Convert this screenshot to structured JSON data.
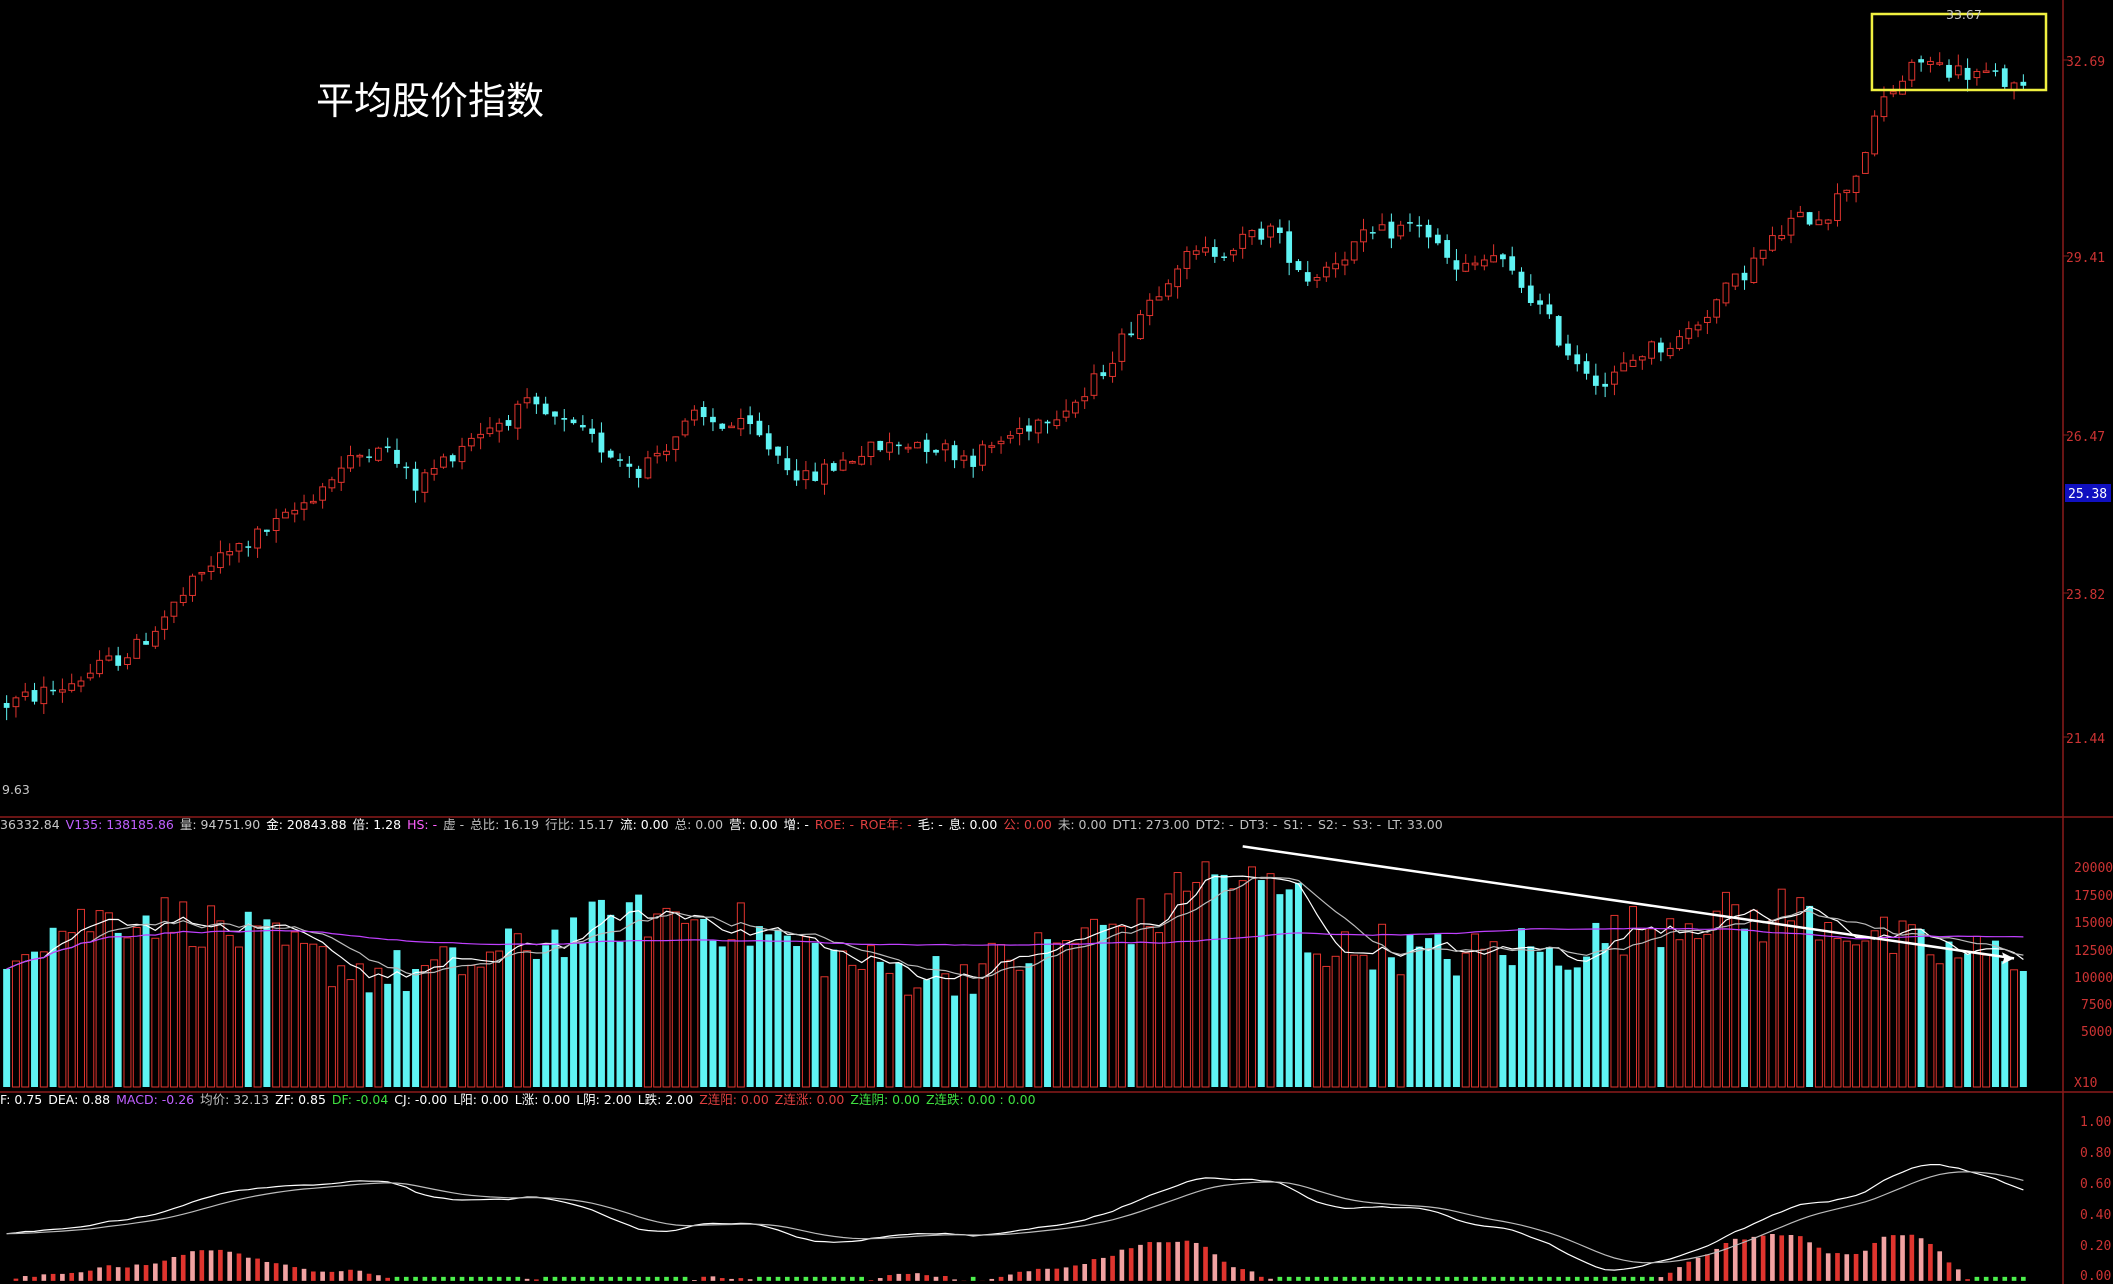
{
  "title": "平均股价指数",
  "colors": {
    "up": "#e0342e",
    "down": "#5ff3f3",
    "frame": "#8b1a1a",
    "ma_white": "#ffffff",
    "ma_gray": "#bbbbbb",
    "ma_purple": "#c040ff",
    "highlight": "#f0f040",
    "price_tag_bg": "#1010c0",
    "macd_pos": "#e0342e",
    "macd_pos_light": "#f2a2a2",
    "macd_neg": "#4df04d"
  },
  "price_axis": {
    "ticks": [
      "32.69",
      "29.41",
      "26.47",
      "23.82",
      "21.44"
    ],
    "current_price": "25.38",
    "high_label": "33.67",
    "low_label": "9.63"
  },
  "volume_axis": {
    "ticks": [
      "20000",
      "17500",
      "15000",
      "12500",
      "10000",
      "7500",
      "5000"
    ],
    "unit": "X10"
  },
  "macd_axis": {
    "ticks": [
      "1.00",
      "0.80",
      "0.60",
      "0.40",
      "0.20",
      "0.00"
    ]
  },
  "volume_info": [
    {
      "text": "36332.84",
      "color": "#c8c8c8"
    },
    {
      "text": "V135: 138185.86",
      "color": "#c060ff"
    },
    {
      "text": "量: 94751.90",
      "color": "#c8c8c8"
    },
    {
      "text": "金: 20843.88",
      "color": "#ffffff"
    },
    {
      "text": "倍: 1.28",
      "color": "#ffffff"
    },
    {
      "text": "HS: -",
      "color": "#ff60ff"
    },
    {
      "text": "虚 -",
      "color": "#c0c0c0"
    },
    {
      "text": "总比: 16.19",
      "color": "#c0c0c0"
    },
    {
      "text": "行比: 15.17",
      "color": "#c0c0c0"
    },
    {
      "text": "流: 0.00",
      "color": "#ffffff"
    },
    {
      "text": "总: 0.00",
      "color": "#c0c0c0"
    },
    {
      "text": "营: 0.00",
      "color": "#ffffff"
    },
    {
      "text": "增: -",
      "color": "#ffffff"
    },
    {
      "text": "ROE: -",
      "color": "#e04040"
    },
    {
      "text": "ROE年: -",
      "color": "#e04040"
    },
    {
      "text": "毛: -",
      "color": "#ffffff"
    },
    {
      "text": "息: 0.00",
      "color": "#ffffff"
    },
    {
      "text": "公: 0.00",
      "color": "#e04040"
    },
    {
      "text": "未: 0.00",
      "color": "#c0c0c0"
    },
    {
      "text": "DT1: 273.00",
      "color": "#c0c0c0"
    },
    {
      "text": "DT2: -",
      "color": "#c0c0c0"
    },
    {
      "text": "DT3: -",
      "color": "#c0c0c0"
    },
    {
      "text": "S1: -",
      "color": "#c0c0c0"
    },
    {
      "text": "S2: -",
      "color": "#c0c0c0"
    },
    {
      "text": "S3: -",
      "color": "#c0c0c0"
    },
    {
      "text": "LT: 33.00",
      "color": "#c0c0c0"
    }
  ],
  "macd_info": [
    {
      "text": "F: 0.75",
      "color": "#ffffff"
    },
    {
      "text": "DEA: 0.88",
      "color": "#ffffff"
    },
    {
      "text": "MACD: -0.26",
      "color": "#c060ff"
    },
    {
      "text": "均价: 32.13",
      "color": "#c0c0c0"
    },
    {
      "text": "ZF: 0.85",
      "color": "#ffffff"
    },
    {
      "text": "DF: -0.04",
      "color": "#40e040"
    },
    {
      "text": "CJ: -0.00",
      "color": "#ffffff"
    },
    {
      "text": "L阳: 0.00",
      "color": "#ffffff"
    },
    {
      "text": "L涨: 0.00",
      "color": "#ffffff"
    },
    {
      "text": "L阴: 2.00",
      "color": "#ffffff"
    },
    {
      "text": "L跌: 2.00",
      "color": "#ffffff"
    },
    {
      "text": "Z连阳: 0.00",
      "color": "#e04040"
    },
    {
      "text": "Z连涨: 0.00",
      "color": "#e04040"
    },
    {
      "text": "Z连阴: 0.00",
      "color": "#40e040"
    },
    {
      "text": "Z连跌: 0.00 : 0.00",
      "color": "#40e040"
    }
  ],
  "chart_data": {
    "type": "candlestick",
    "title": "平均股价指数",
    "price_path": [
      [
        0,
        21.5
      ],
      [
        6,
        21.8
      ],
      [
        14,
        22.5
      ],
      [
        22,
        24.0
      ],
      [
        30,
        24.8
      ],
      [
        36,
        25.7
      ],
      [
        40,
        26.2
      ],
      [
        44,
        25.4
      ],
      [
        50,
        26.3
      ],
      [
        56,
        26.8
      ],
      [
        62,
        26.3
      ],
      [
        68,
        25.7
      ],
      [
        74,
        26.6
      ],
      [
        80,
        26.4
      ],
      [
        86,
        25.5
      ],
      [
        92,
        26.0
      ],
      [
        98,
        26.2
      ],
      [
        104,
        25.9
      ],
      [
        110,
        26.5
      ],
      [
        116,
        27.0
      ],
      [
        122,
        28.5
      ],
      [
        126,
        29.4
      ],
      [
        132,
        29.7
      ],
      [
        136,
        30.0
      ],
      [
        140,
        29.1
      ],
      [
        146,
        29.8
      ],
      [
        152,
        30.1
      ],
      [
        156,
        29.2
      ],
      [
        160,
        29.5
      ],
      [
        164,
        28.8
      ],
      [
        168,
        27.8
      ],
      [
        172,
        27.2
      ],
      [
        176,
        27.8
      ],
      [
        180,
        28.0
      ],
      [
        184,
        28.7
      ],
      [
        188,
        29.4
      ],
      [
        192,
        30.1
      ],
      [
        196,
        30.3
      ],
      [
        199,
        31.0
      ],
      [
        202,
        32.3
      ],
      [
        206,
        33.0
      ],
      [
        210,
        32.8
      ],
      [
        214,
        32.7
      ],
      [
        217,
        32.4
      ]
    ],
    "candle_count": 218,
    "price_range": [
      20.5,
      33.9
    ],
    "volume_range": [
      0,
      22000
    ],
    "volume_ticks": [
      20000,
      17500,
      15000,
      12500,
      10000,
      7500,
      5000
    ],
    "macd_range": [
      -0.02,
      1.1
    ],
    "macd_ticks": [
      1.0,
      0.8,
      0.6,
      0.4,
      0.2,
      0.0
    ],
    "highlight_box_from_candle": 202,
    "volume_trendline_from_candle": 133,
    "volume_trendline_to_candle": 216
  }
}
